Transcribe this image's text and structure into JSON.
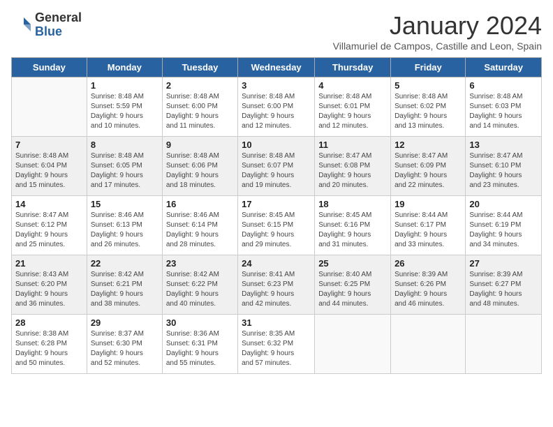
{
  "logo": {
    "general": "General",
    "blue": "Blue"
  },
  "title": "January 2024",
  "subtitle": "Villamuriel de Campos, Castille and Leon, Spain",
  "days_of_week": [
    "Sunday",
    "Monday",
    "Tuesday",
    "Wednesday",
    "Thursday",
    "Friday",
    "Saturday"
  ],
  "weeks": [
    [
      {
        "day": "",
        "info": ""
      },
      {
        "day": "1",
        "info": "Sunrise: 8:48 AM\nSunset: 5:59 PM\nDaylight: 9 hours\nand 10 minutes."
      },
      {
        "day": "2",
        "info": "Sunrise: 8:48 AM\nSunset: 6:00 PM\nDaylight: 9 hours\nand 11 minutes."
      },
      {
        "day": "3",
        "info": "Sunrise: 8:48 AM\nSunset: 6:00 PM\nDaylight: 9 hours\nand 12 minutes."
      },
      {
        "day": "4",
        "info": "Sunrise: 8:48 AM\nSunset: 6:01 PM\nDaylight: 9 hours\nand 12 minutes."
      },
      {
        "day": "5",
        "info": "Sunrise: 8:48 AM\nSunset: 6:02 PM\nDaylight: 9 hours\nand 13 minutes."
      },
      {
        "day": "6",
        "info": "Sunrise: 8:48 AM\nSunset: 6:03 PM\nDaylight: 9 hours\nand 14 minutes."
      }
    ],
    [
      {
        "day": "7",
        "info": "Sunrise: 8:48 AM\nSunset: 6:04 PM\nDaylight: 9 hours\nand 15 minutes."
      },
      {
        "day": "8",
        "info": "Sunrise: 8:48 AM\nSunset: 6:05 PM\nDaylight: 9 hours\nand 17 minutes."
      },
      {
        "day": "9",
        "info": "Sunrise: 8:48 AM\nSunset: 6:06 PM\nDaylight: 9 hours\nand 18 minutes."
      },
      {
        "day": "10",
        "info": "Sunrise: 8:48 AM\nSunset: 6:07 PM\nDaylight: 9 hours\nand 19 minutes."
      },
      {
        "day": "11",
        "info": "Sunrise: 8:47 AM\nSunset: 6:08 PM\nDaylight: 9 hours\nand 20 minutes."
      },
      {
        "day": "12",
        "info": "Sunrise: 8:47 AM\nSunset: 6:09 PM\nDaylight: 9 hours\nand 22 minutes."
      },
      {
        "day": "13",
        "info": "Sunrise: 8:47 AM\nSunset: 6:10 PM\nDaylight: 9 hours\nand 23 minutes."
      }
    ],
    [
      {
        "day": "14",
        "info": "Sunrise: 8:47 AM\nSunset: 6:12 PM\nDaylight: 9 hours\nand 25 minutes."
      },
      {
        "day": "15",
        "info": "Sunrise: 8:46 AM\nSunset: 6:13 PM\nDaylight: 9 hours\nand 26 minutes."
      },
      {
        "day": "16",
        "info": "Sunrise: 8:46 AM\nSunset: 6:14 PM\nDaylight: 9 hours\nand 28 minutes."
      },
      {
        "day": "17",
        "info": "Sunrise: 8:45 AM\nSunset: 6:15 PM\nDaylight: 9 hours\nand 29 minutes."
      },
      {
        "day": "18",
        "info": "Sunrise: 8:45 AM\nSunset: 6:16 PM\nDaylight: 9 hours\nand 31 minutes."
      },
      {
        "day": "19",
        "info": "Sunrise: 8:44 AM\nSunset: 6:17 PM\nDaylight: 9 hours\nand 33 minutes."
      },
      {
        "day": "20",
        "info": "Sunrise: 8:44 AM\nSunset: 6:19 PM\nDaylight: 9 hours\nand 34 minutes."
      }
    ],
    [
      {
        "day": "21",
        "info": "Sunrise: 8:43 AM\nSunset: 6:20 PM\nDaylight: 9 hours\nand 36 minutes."
      },
      {
        "day": "22",
        "info": "Sunrise: 8:42 AM\nSunset: 6:21 PM\nDaylight: 9 hours\nand 38 minutes."
      },
      {
        "day": "23",
        "info": "Sunrise: 8:42 AM\nSunset: 6:22 PM\nDaylight: 9 hours\nand 40 minutes."
      },
      {
        "day": "24",
        "info": "Sunrise: 8:41 AM\nSunset: 6:23 PM\nDaylight: 9 hours\nand 42 minutes."
      },
      {
        "day": "25",
        "info": "Sunrise: 8:40 AM\nSunset: 6:25 PM\nDaylight: 9 hours\nand 44 minutes."
      },
      {
        "day": "26",
        "info": "Sunrise: 8:39 AM\nSunset: 6:26 PM\nDaylight: 9 hours\nand 46 minutes."
      },
      {
        "day": "27",
        "info": "Sunrise: 8:39 AM\nSunset: 6:27 PM\nDaylight: 9 hours\nand 48 minutes."
      }
    ],
    [
      {
        "day": "28",
        "info": "Sunrise: 8:38 AM\nSunset: 6:28 PM\nDaylight: 9 hours\nand 50 minutes."
      },
      {
        "day": "29",
        "info": "Sunrise: 8:37 AM\nSunset: 6:30 PM\nDaylight: 9 hours\nand 52 minutes."
      },
      {
        "day": "30",
        "info": "Sunrise: 8:36 AM\nSunset: 6:31 PM\nDaylight: 9 hours\nand 55 minutes."
      },
      {
        "day": "31",
        "info": "Sunrise: 8:35 AM\nSunset: 6:32 PM\nDaylight: 9 hours\nand 57 minutes."
      },
      {
        "day": "",
        "info": ""
      },
      {
        "day": "",
        "info": ""
      },
      {
        "day": "",
        "info": ""
      }
    ]
  ]
}
